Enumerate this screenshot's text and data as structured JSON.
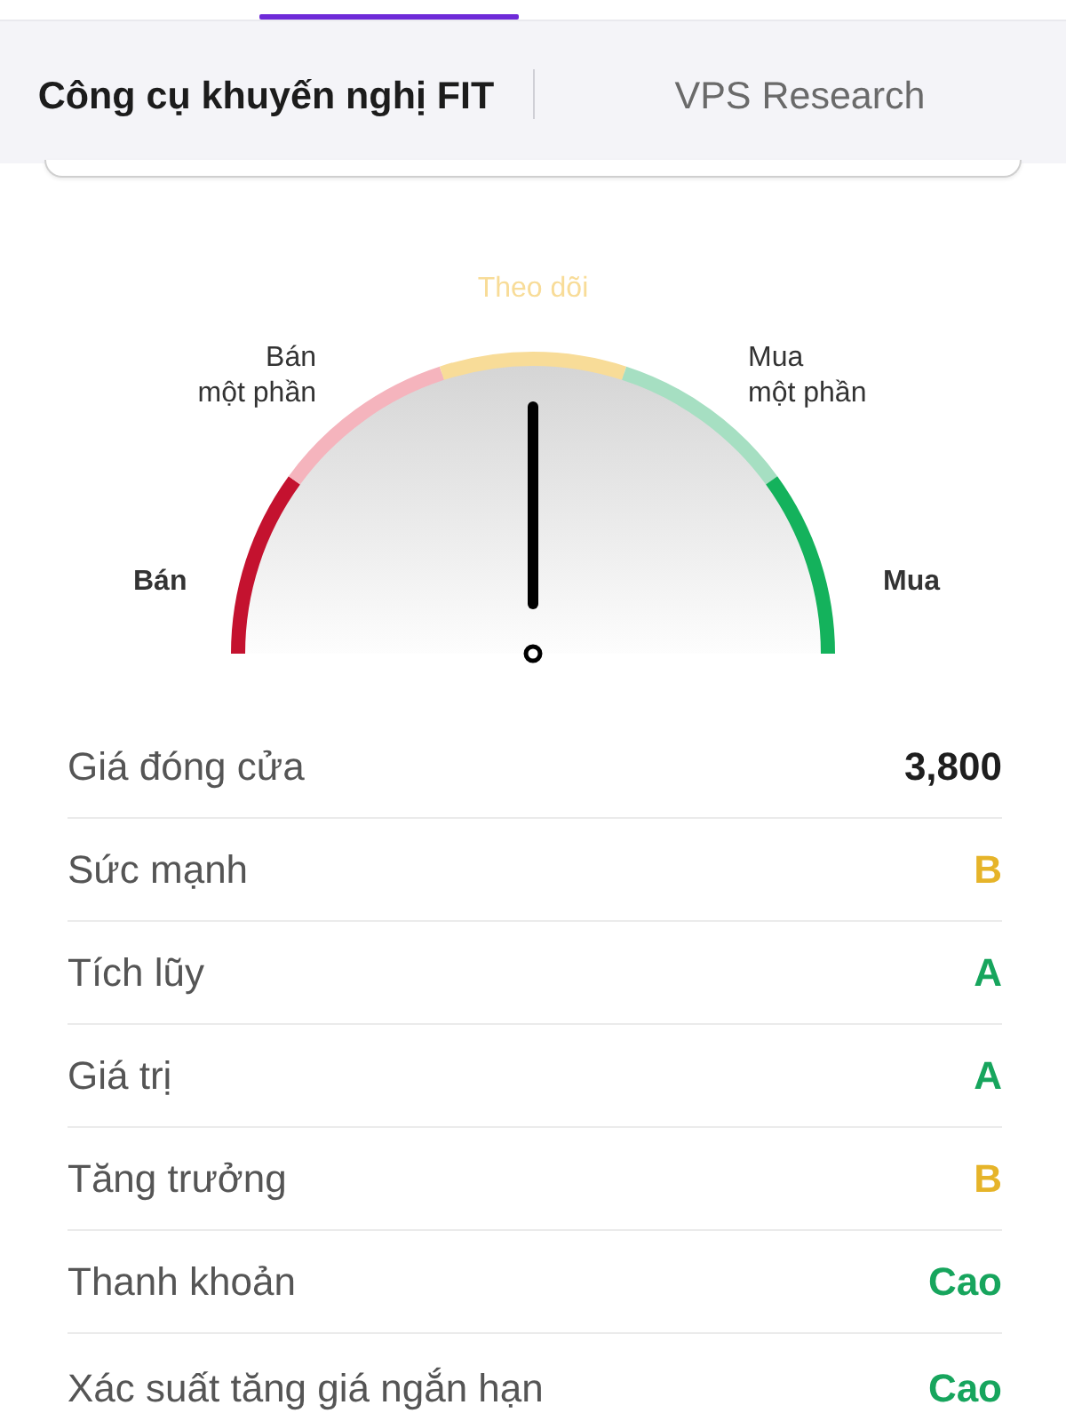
{
  "tabs": [
    {
      "label": "Công cụ khuyến nghị FIT",
      "selected": true
    },
    {
      "label": "VPS Research",
      "selected": false
    }
  ],
  "gauge": {
    "level": 0.5,
    "zones": [
      {
        "label": "Bán",
        "color": "#c4122f",
        "bold": true,
        "selected": false
      },
      {
        "label": "Bán\nmột phần",
        "color": "#f5b4bd",
        "bold": false,
        "selected": false
      },
      {
        "label": "Theo dõi",
        "color": "#f8dc98",
        "bold": false,
        "selected": true
      },
      {
        "label": "Mua\nmột phần",
        "color": "#a6dfc2",
        "bold": false,
        "selected": false
      },
      {
        "label": "Mua",
        "color": "#14b25c",
        "bold": true,
        "selected": false
      }
    ]
  },
  "metrics": [
    {
      "label": "Giá đóng cửa",
      "value": "3,800",
      "color": "#1e1e1e"
    },
    {
      "label": "Sức mạnh",
      "value": "B",
      "color": "#e6b429"
    },
    {
      "label": "Tích lũy",
      "value": "A",
      "color": "#17a55d"
    },
    {
      "label": "Giá trị",
      "value": "A",
      "color": "#17a55d"
    },
    {
      "label": "Tăng trưởng",
      "value": "B",
      "color": "#e6b429"
    },
    {
      "label": "Thanh khoản",
      "value": "Cao",
      "color": "#17a55d"
    },
    {
      "label": "Xác suất tăng giá ngắn hạn",
      "value": "Cao",
      "color": "#17a55d"
    }
  ]
}
